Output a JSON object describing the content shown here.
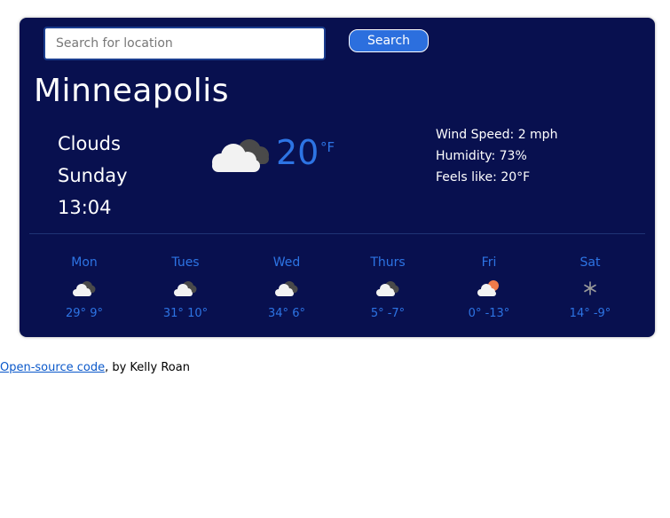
{
  "search": {
    "placeholder": "Search for location",
    "value": "",
    "button_label": "Search"
  },
  "current": {
    "city": "Minneapolis",
    "description": "Clouds",
    "day": "Sunday",
    "time": "13:04",
    "temperature": "20",
    "unit": "°F",
    "icon": "clouds-icon",
    "wind": "Wind Speed: 2 mph",
    "humidity": "Humidity: 73%",
    "feels_like": "Feels like: 20°F"
  },
  "forecast": [
    {
      "day": "Mon",
      "temps": "29° 9°",
      "icon": "clouds-icon"
    },
    {
      "day": "Tues",
      "temps": "31° 10°",
      "icon": "clouds-icon"
    },
    {
      "day": "Wed",
      "temps": "34° 6°",
      "icon": "clouds-icon"
    },
    {
      "day": "Thurs",
      "temps": "5° -7°",
      "icon": "clouds-icon"
    },
    {
      "day": "Fri",
      "temps": "0° -13°",
      "icon": "partly-sunny-icon"
    },
    {
      "day": "Sat",
      "temps": "14° -9°",
      "icon": "snowflake-icon"
    }
  ],
  "footer": {
    "link_text": "Open-source code",
    "suffix": ", by Kelly Roan"
  },
  "colors": {
    "card_bg": "#08104f",
    "accent": "#2d74e4",
    "button": "#2c6fde",
    "text": "#ffffff"
  }
}
